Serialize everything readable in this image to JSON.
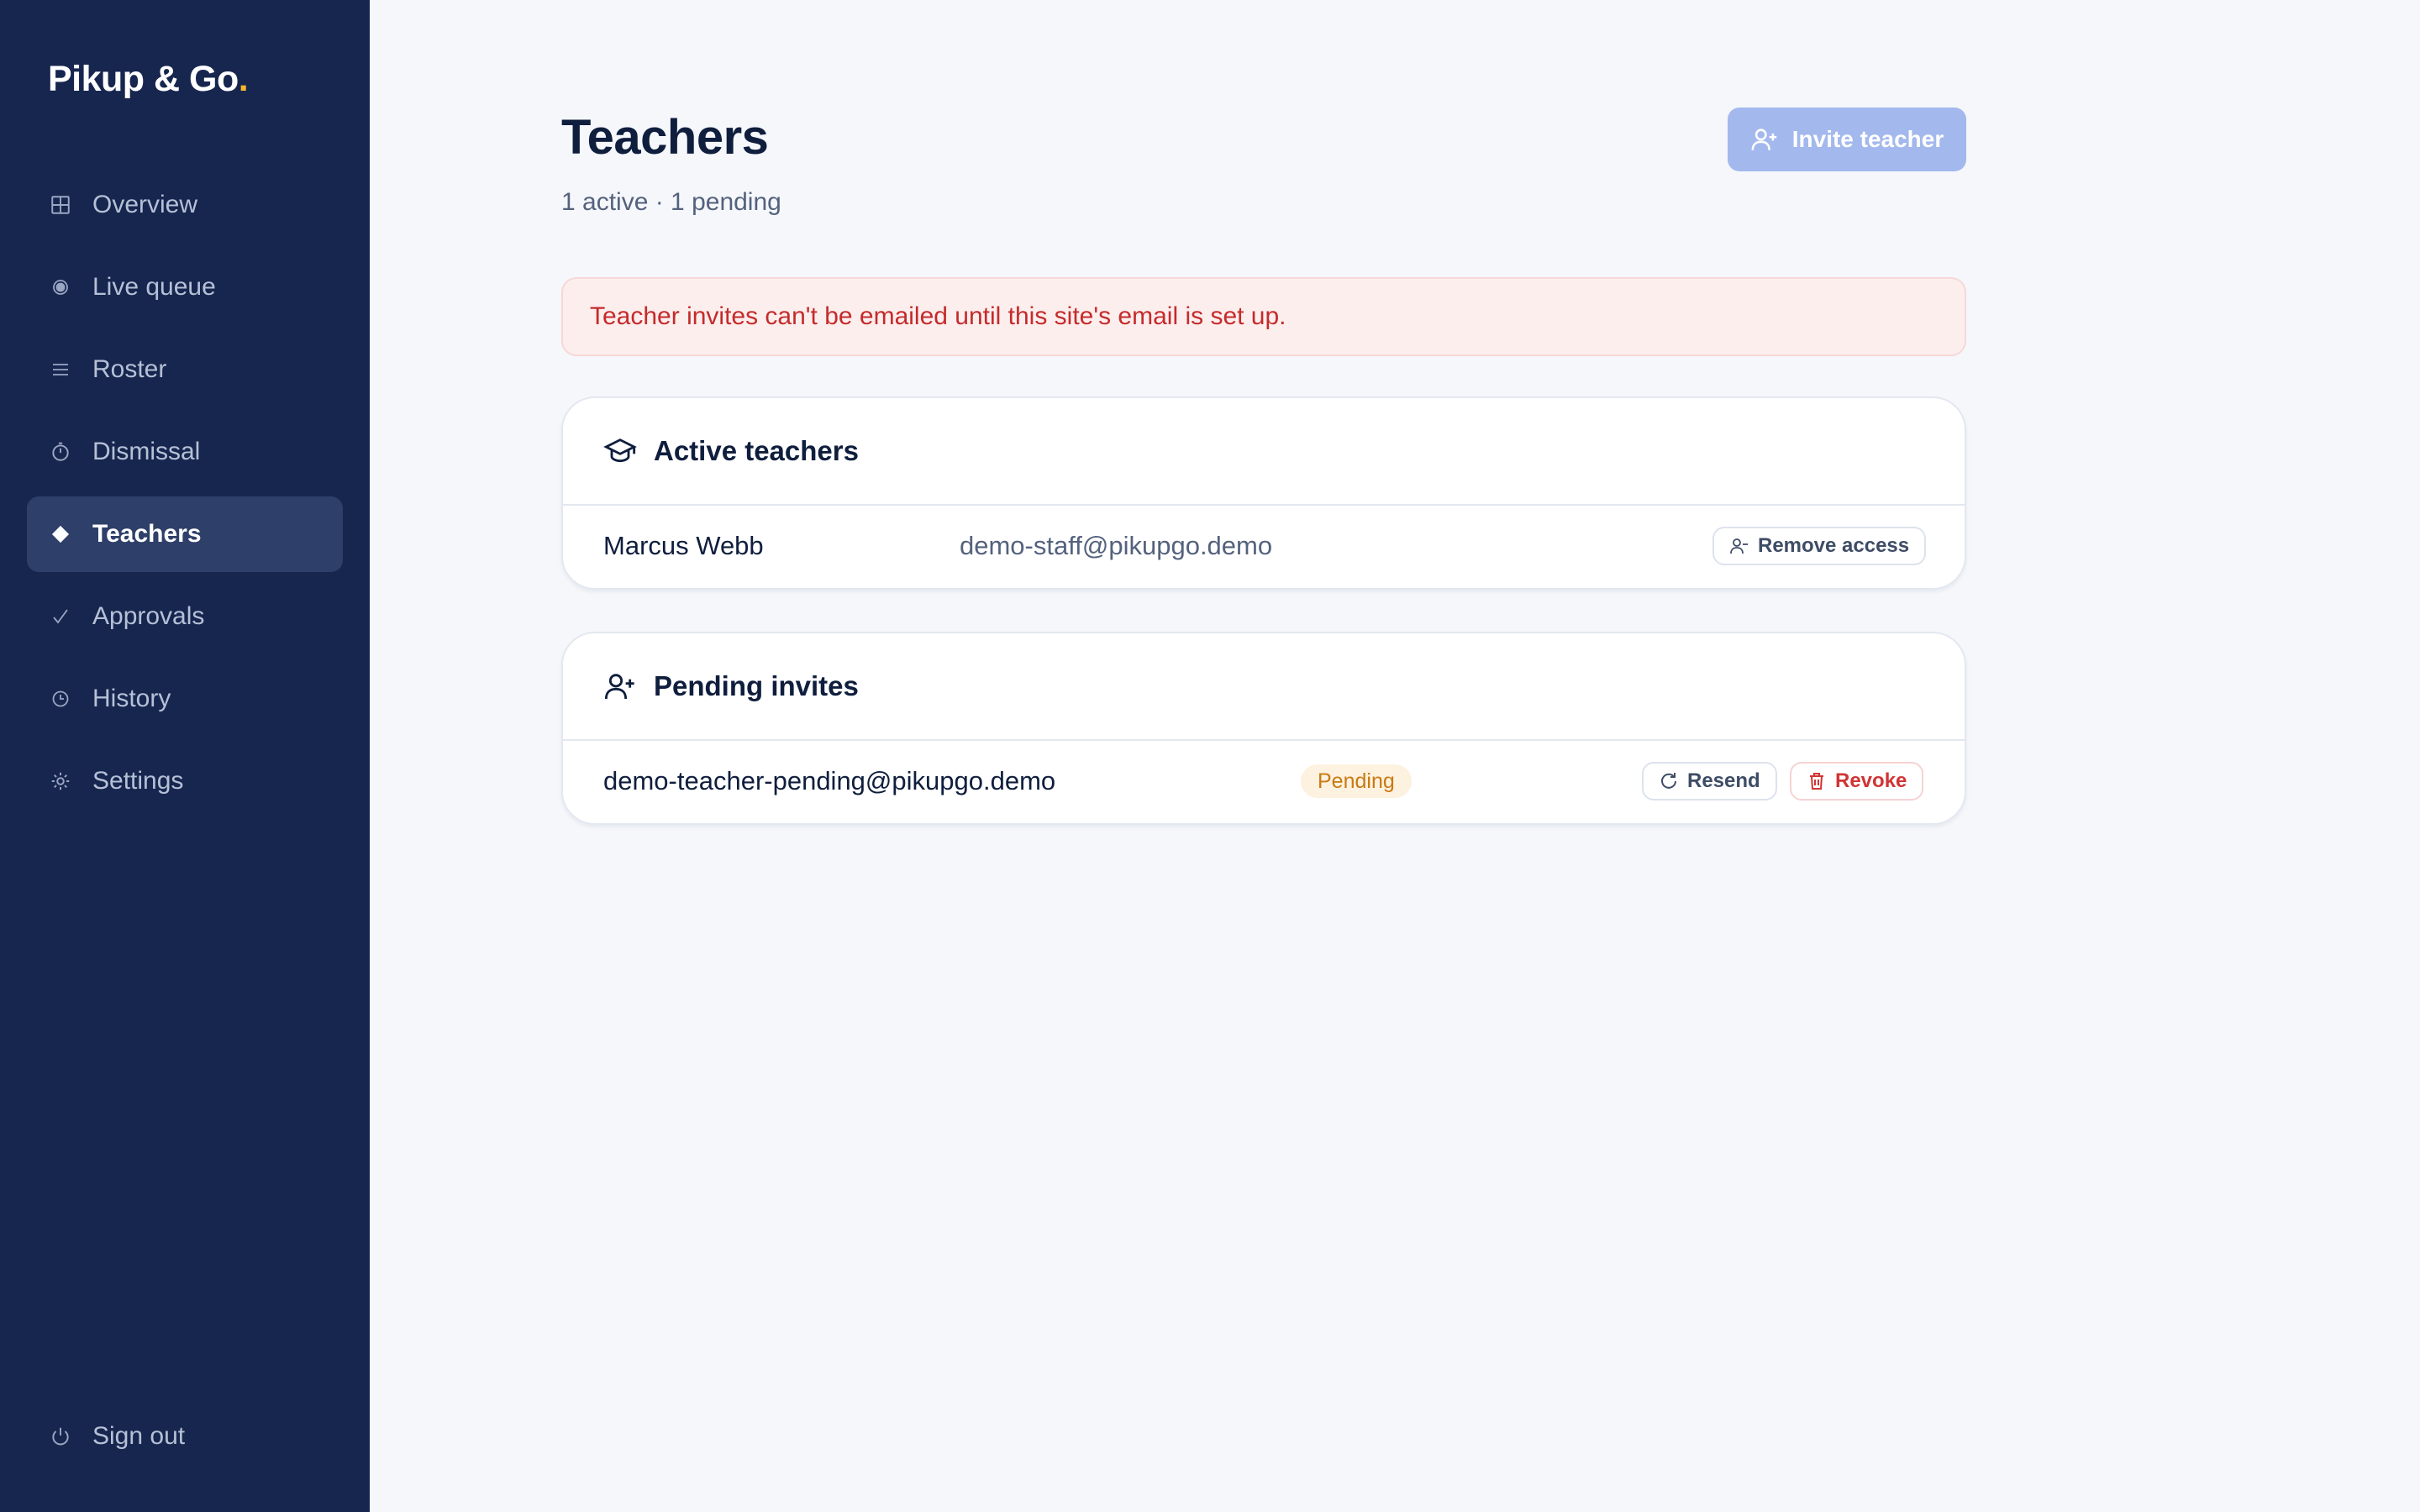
{
  "brand": {
    "name": "Pikup & Go",
    "dot": "."
  },
  "sidebar": {
    "items": [
      {
        "label": "Overview",
        "icon": "grid-icon"
      },
      {
        "label": "Live queue",
        "icon": "radio-dot-icon"
      },
      {
        "label": "Roster",
        "icon": "list-icon"
      },
      {
        "label": "Dismissal",
        "icon": "timer-icon"
      },
      {
        "label": "Teachers",
        "icon": "diamond-icon",
        "active": true
      },
      {
        "label": "Approvals",
        "icon": "check-icon"
      },
      {
        "label": "History",
        "icon": "clock-icon"
      },
      {
        "label": "Settings",
        "icon": "gear-icon"
      }
    ],
    "signout": {
      "label": "Sign out",
      "icon": "power-icon"
    }
  },
  "header": {
    "title": "Teachers",
    "subtitle": "1 active · 1 pending",
    "invite_label": "Invite teacher"
  },
  "alert": {
    "text": "Teacher invites can't be emailed until this site's email is set up."
  },
  "active": {
    "title": "Active teachers",
    "rows": [
      {
        "name": "Marcus Webb",
        "email": "demo-staff@pikupgo.demo",
        "action": "Remove access"
      }
    ]
  },
  "pending": {
    "title": "Pending invites",
    "rows": [
      {
        "email": "demo-teacher-pending@pikupgo.demo",
        "status": "Pending",
        "resend": "Resend",
        "revoke": "Revoke"
      }
    ]
  },
  "colors": {
    "sidebar_bg": "#17264f",
    "accent": "#a3b8ed",
    "brand_dot": "#f5b72b",
    "alert_text": "#c42b2b",
    "pending_badge": "#c97a12"
  }
}
